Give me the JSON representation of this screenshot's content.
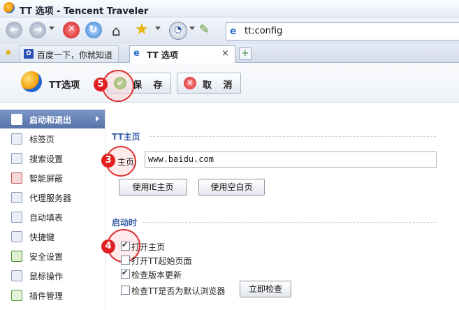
{
  "window": {
    "title": "TT 选项 - Tencent Traveler"
  },
  "address_bar": {
    "url": "tt:config"
  },
  "tabs": [
    {
      "label": "百度一下，你就知道"
    },
    {
      "label": "TT 选项",
      "close": "×"
    }
  ],
  "options_header": {
    "title": "TT选项",
    "save_label": "保 存",
    "cancel_label": "取 消"
  },
  "sidebar": {
    "items": [
      {
        "label": "启动和退出",
        "icon": "startup-icon",
        "active": true
      },
      {
        "label": "标签页",
        "icon": "tabs-icon"
      },
      {
        "label": "搜索设置",
        "icon": "search-icon"
      },
      {
        "label": "智能屏蔽",
        "icon": "block-icon"
      },
      {
        "label": "代理服务器",
        "icon": "proxy-icon"
      },
      {
        "label": "自动填表",
        "icon": "autofill-icon"
      },
      {
        "label": "快捷键",
        "icon": "hotkey-icon"
      },
      {
        "label": "安全设置",
        "icon": "security-icon"
      },
      {
        "label": "鼠标操作",
        "icon": "mouse-icon"
      },
      {
        "label": "插件管理",
        "icon": "plugin-icon"
      }
    ]
  },
  "homepage_section": {
    "title": "TT主页",
    "label": "主页:",
    "value": "www.baidu.com",
    "use_ie_button": "使用IE主页",
    "use_blank_button": "使用空白页"
  },
  "startup_section": {
    "title": "启动时",
    "options": [
      {
        "label": "打开主页",
        "checked": true
      },
      {
        "label": "打开TT起始页面",
        "checked": false
      },
      {
        "label": "检查版本更新",
        "checked": true
      },
      {
        "label": "检查TT是否为默认浏览器",
        "checked": false
      }
    ],
    "check_now_button": "立即检查"
  },
  "annotations": {
    "badge_save": "5",
    "badge_homepage": "3",
    "badge_open_home": "4"
  },
  "colors": {
    "accent": "#5673a8",
    "section_title": "#3a5fa8",
    "annotation_red": "#e02020"
  }
}
